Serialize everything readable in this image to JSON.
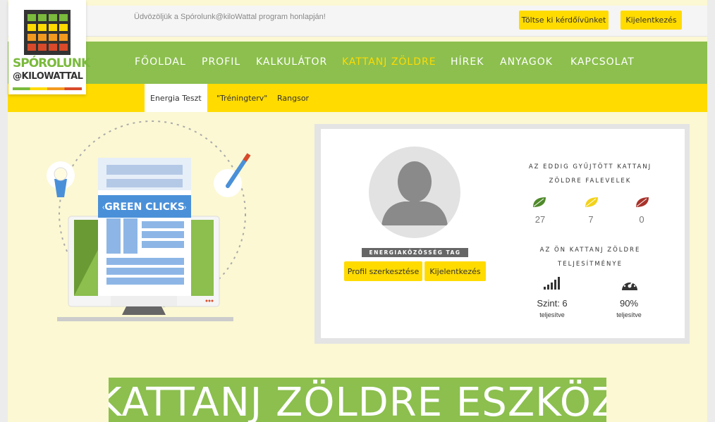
{
  "topbar": {
    "welcome": "Üdvözöljük a Spórolunk@kiloWattal program honlapján!",
    "survey_button": "Töltse ki kérdőívünket",
    "logout_button": "Kijelentkezés"
  },
  "logo": {
    "line1": "SPÓROLUNK",
    "line2": "@KILOWATTAL"
  },
  "nav": {
    "items": [
      "FŐOLDAL",
      "PROFIL",
      "KALKULÁTOR",
      "KATTANJ ZÖLDRE",
      "HÍREK",
      "ANYAGOK",
      "KAPCSOLAT"
    ],
    "active": "KATTANJ ZÖLDRE"
  },
  "subnav": {
    "items": [
      "Energia Teszt",
      "\"Tréningterv\"",
      "Rangsor"
    ]
  },
  "illustration": {
    "banner": "GREEN CLICKS"
  },
  "profile": {
    "badge": "ENERGIAKÖZÖSSÉG TAG",
    "edit_button": "Profil szerkesztése",
    "logout_button": "Kijelentkezés"
  },
  "leaves": {
    "title": "AZ EDDIG GYŰJTÖTT KATTANJ ZÖLDRE FALEVELEK",
    "green": "27",
    "yellow": "7",
    "red": "0",
    "colors": {
      "green": "#4f8a2b",
      "yellow": "#f2d21b",
      "red": "#a8332b"
    }
  },
  "performance": {
    "title": "AZ ÖN KATTANJ ZÖLDRE TELJESÍTMÉNYE",
    "level": "Szint: 6",
    "level_sub": "teljesítve",
    "percent": "90%",
    "percent_sub": "teljesítve"
  },
  "hero": {
    "title": "KATTANJ ZÖLDRE ESZKÖZ"
  }
}
